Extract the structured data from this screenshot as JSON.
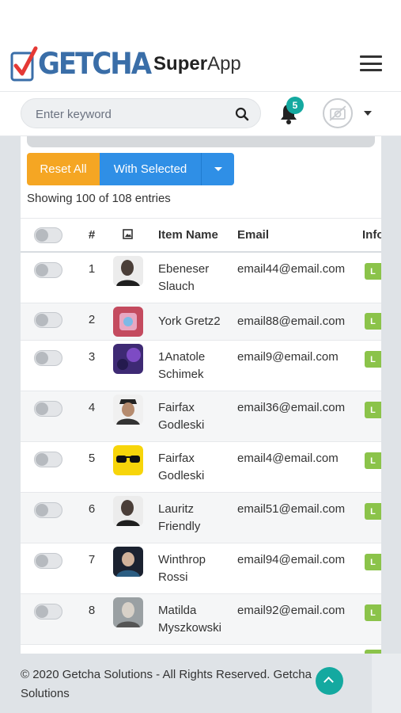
{
  "header": {
    "brand_logo": "GETCHA",
    "brand_super": "Super",
    "brand_app": "App",
    "menu_icon": "hamburger-icon"
  },
  "search": {
    "placeholder": "Enter keyword",
    "icon": "search-icon"
  },
  "notifications": {
    "count": "5",
    "icon": "bell-icon"
  },
  "user": {
    "avatar_icon": "no-camera-avatar-icon"
  },
  "toolbar": {
    "reset_label": "Reset All",
    "with_selected_label": "With Selected",
    "dropdown_icon": "chevron-down-icon"
  },
  "table": {
    "showing_text": "Showing 100 of 108 entries",
    "columns": [
      "#",
      "Item Name",
      "Email",
      "Info"
    ],
    "image_column_icon": "image-icon",
    "rows": [
      {
        "num": "1",
        "name": "Ebeneser Slauch",
        "email": "email44@email.com",
        "info": "L"
      },
      {
        "num": "2",
        "name": "York Gretz2",
        "email": "email88@email.com",
        "info": "L"
      },
      {
        "num": "3",
        "name": "1Anatole Schimek",
        "email": "email9@email.com",
        "info": "L"
      },
      {
        "num": "4",
        "name": "Fairfax Godleski",
        "email": "email36@email.com",
        "info": "L"
      },
      {
        "num": "5",
        "name": "Fairfax Godleski",
        "email": "email4@email.com",
        "info": "L"
      },
      {
        "num": "6",
        "name": "Lauritz Friendly",
        "email": "email51@email.com",
        "info": "L"
      },
      {
        "num": "7",
        "name": "Winthrop Rossi",
        "email": "email94@email.com",
        "info": "L"
      },
      {
        "num": "8",
        "name": "Matilda Myszkowski",
        "email": "email92@email.com",
        "info": "L"
      }
    ]
  },
  "footer": {
    "copyright": "© 2020 Getcha Solutions - All Rights Reserved. Getcha Solutions",
    "scroll_top_icon": "chevron-up-icon"
  },
  "colors": {
    "reset": "#f5a623",
    "with_selected": "#2f8fe6",
    "badge": "#14a9a0",
    "info_label": "#8bc34a",
    "logo_blue": "#3a6ea8",
    "logo_red": "#e53935"
  }
}
